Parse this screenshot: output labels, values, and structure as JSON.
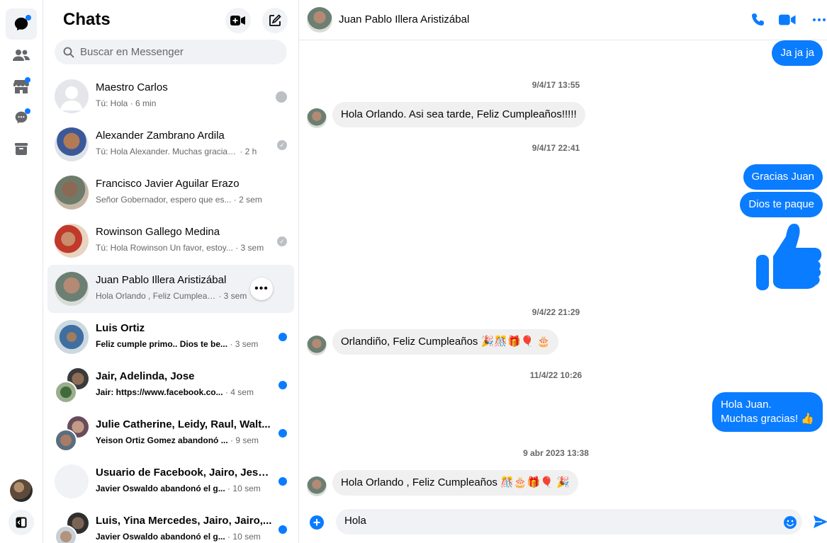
{
  "rail": {
    "items": [
      {
        "icon": "chat-bubble-icon",
        "active": true,
        "badge": true
      },
      {
        "icon": "people-icon",
        "active": false,
        "badge": false
      },
      {
        "icon": "marketplace-icon",
        "active": false,
        "badge": true
      },
      {
        "icon": "message-requests-icon",
        "active": false,
        "badge": true
      },
      {
        "icon": "archive-icon",
        "active": false,
        "badge": false
      }
    ]
  },
  "chats": {
    "title": "Chats",
    "search_placeholder": "Buscar en Messenger",
    "list": [
      {
        "name": "Maestro Carlos",
        "preview": "Tú: Hola",
        "time": "6 min",
        "status": "seen-avatar",
        "unread": false,
        "active": false
      },
      {
        "name": "Alexander Zambrano Ardila",
        "preview": "Tú: Hola Alexander. Muchas gracias ...",
        "time": "2 h",
        "status": "check",
        "unread": false,
        "active": false
      },
      {
        "name": "Francisco Javier Aguilar Erazo",
        "preview": "Señor Gobernador, espero que es...",
        "time": "2 sem",
        "status": "none",
        "unread": false,
        "active": false
      },
      {
        "name": "Rowinson Gallego Medina",
        "preview": "Tú: Hola Rowinson Un favor, estoy...",
        "time": "3 sem",
        "status": "check",
        "unread": false,
        "active": false
      },
      {
        "name": "Juan Pablo Illera Aristizábal",
        "preview": "Hola Orlando , Feliz Cumpleaños ...",
        "time": "3 sem",
        "status": "none",
        "unread": false,
        "active": true
      },
      {
        "name": "Luis Ortiz",
        "preview": "Feliz cumple primo.. Dios te be...",
        "time": "3 sem",
        "status": "dot",
        "unread": true,
        "active": false
      },
      {
        "name": "Jair, Adelinda, Jose",
        "preview": "Jair: https://www.facebook.co...",
        "time": "4 sem",
        "status": "dot",
        "unread": true,
        "active": false
      },
      {
        "name": "Julie Catherine, Leidy, Raul, Walt...",
        "preview": "Yeison Ortiz Gomez abandonó ...",
        "time": "9 sem",
        "status": "dot",
        "unread": true,
        "active": false
      },
      {
        "name": "Usuario de Facebook, Jairo, Jesu...",
        "preview": "Javier Oswaldo abandonó el g...",
        "time": "10 sem",
        "status": "dot",
        "unread": true,
        "active": false
      },
      {
        "name": "Luis, Yina Mercedes, Jairo, Jairo,...",
        "preview": "Javier Oswaldo abandonó el g...",
        "time": "10 sem",
        "status": "dot",
        "unread": true,
        "active": false
      }
    ]
  },
  "conversation": {
    "contact_name": "Juan Pablo Illera Aristizábal",
    "messages": [
      {
        "kind": "out",
        "text": "Ja ja ja"
      },
      {
        "kind": "timestamp",
        "text": "9/4/17 13:55"
      },
      {
        "kind": "in",
        "text": "Hola Orlando. Asi sea tarde, Feliz Cumpleaños!!!!!"
      },
      {
        "kind": "timestamp",
        "text": "9/4/17 22:41"
      },
      {
        "kind": "out",
        "text": "Gracias Juan"
      },
      {
        "kind": "out",
        "text": "Dios te paque"
      },
      {
        "kind": "like",
        "text": ""
      },
      {
        "kind": "timestamp",
        "text": "9/4/22 21:29"
      },
      {
        "kind": "in",
        "text": "Orlandiño, Feliz Cumpleaños 🎉🎊🎁🎈 🎂"
      },
      {
        "kind": "timestamp",
        "text": "11/4/22 10:26"
      },
      {
        "kind": "out",
        "text": "Hola Juan.\nMuchas gracias! 👍"
      },
      {
        "kind": "timestamp",
        "text": "9 abr 2023 13:38"
      },
      {
        "kind": "in",
        "text": "Hola Orlando , Feliz Cumpleaños 🎊🎂🎁🎈 🎉"
      }
    ],
    "composer_value": "Hola"
  },
  "colors": {
    "accent": "#0a7cff",
    "bubble_in": "#f0f0f0",
    "muted_text": "#65676b"
  }
}
